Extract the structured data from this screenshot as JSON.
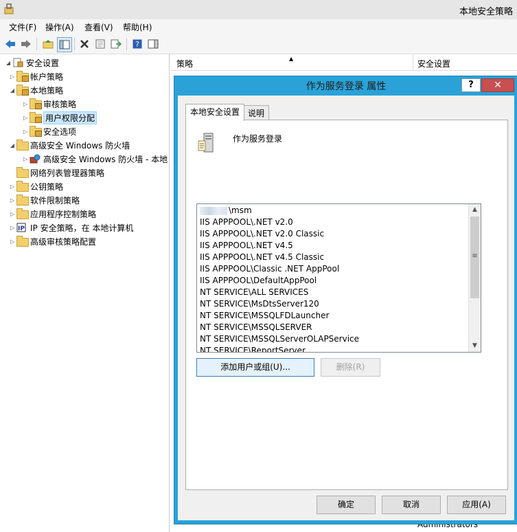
{
  "window": {
    "title": "本地安全策略"
  },
  "menu": {
    "file": "文件(F)",
    "action": "操作(A)",
    "view": "查看(V)",
    "help": "帮助(H)"
  },
  "tree": {
    "root": "安全设置",
    "account_policies": "帐户策略",
    "local_policies": "本地策略",
    "audit_policy": "审核策略",
    "user_rights": "用户权限分配",
    "security_options": "安全选项",
    "firewall": "高级安全 Windows 防火墙",
    "firewall_child": "高级安全 Windows 防火墙 - 本地",
    "network_list": "网络列表管理器策略",
    "public_key": "公钥策略",
    "software_restriction": "软件限制策略",
    "app_control": "应用程序控制策略",
    "ip_security": "IP 安全策略，在 本地计算机",
    "advanced_audit": "高级审核策略配置"
  },
  "list": {
    "col_policy": "策略",
    "col_setting": "安全设置",
    "bottom_setting": "Administrators"
  },
  "dialog": {
    "title": "作为服务登录 属性",
    "help": "?",
    "close": "✕",
    "tab_local": "本地安全设置",
    "tab_explain": "说明",
    "policy_name": "作为服务登录",
    "accounts": [
      "\\msm",
      "IIS APPPOOL\\.NET v2.0",
      "IIS APPPOOL\\.NET v2.0 Classic",
      "IIS APPPOOL\\.NET v4.5",
      "IIS APPPOOL\\.NET v4.5 Classic",
      "IIS APPPOOL\\Classic .NET AppPool",
      "IIS APPPOOL\\DefaultAppPool",
      "NT SERVICE\\ALL SERVICES",
      "NT SERVICE\\MsDtsServer120",
      "NT SERVICE\\MSSQLFDLauncher",
      "NT SERVICE\\MSSQLSERVER",
      "NT SERVICE\\MSSQLServerOLAPService",
      "NT SERVICE\\ReportServer"
    ],
    "add_button": "添加用户或组(U)...",
    "remove_button": "删除(R)",
    "ok": "确定",
    "cancel": "取消",
    "apply": "应用(A)"
  }
}
